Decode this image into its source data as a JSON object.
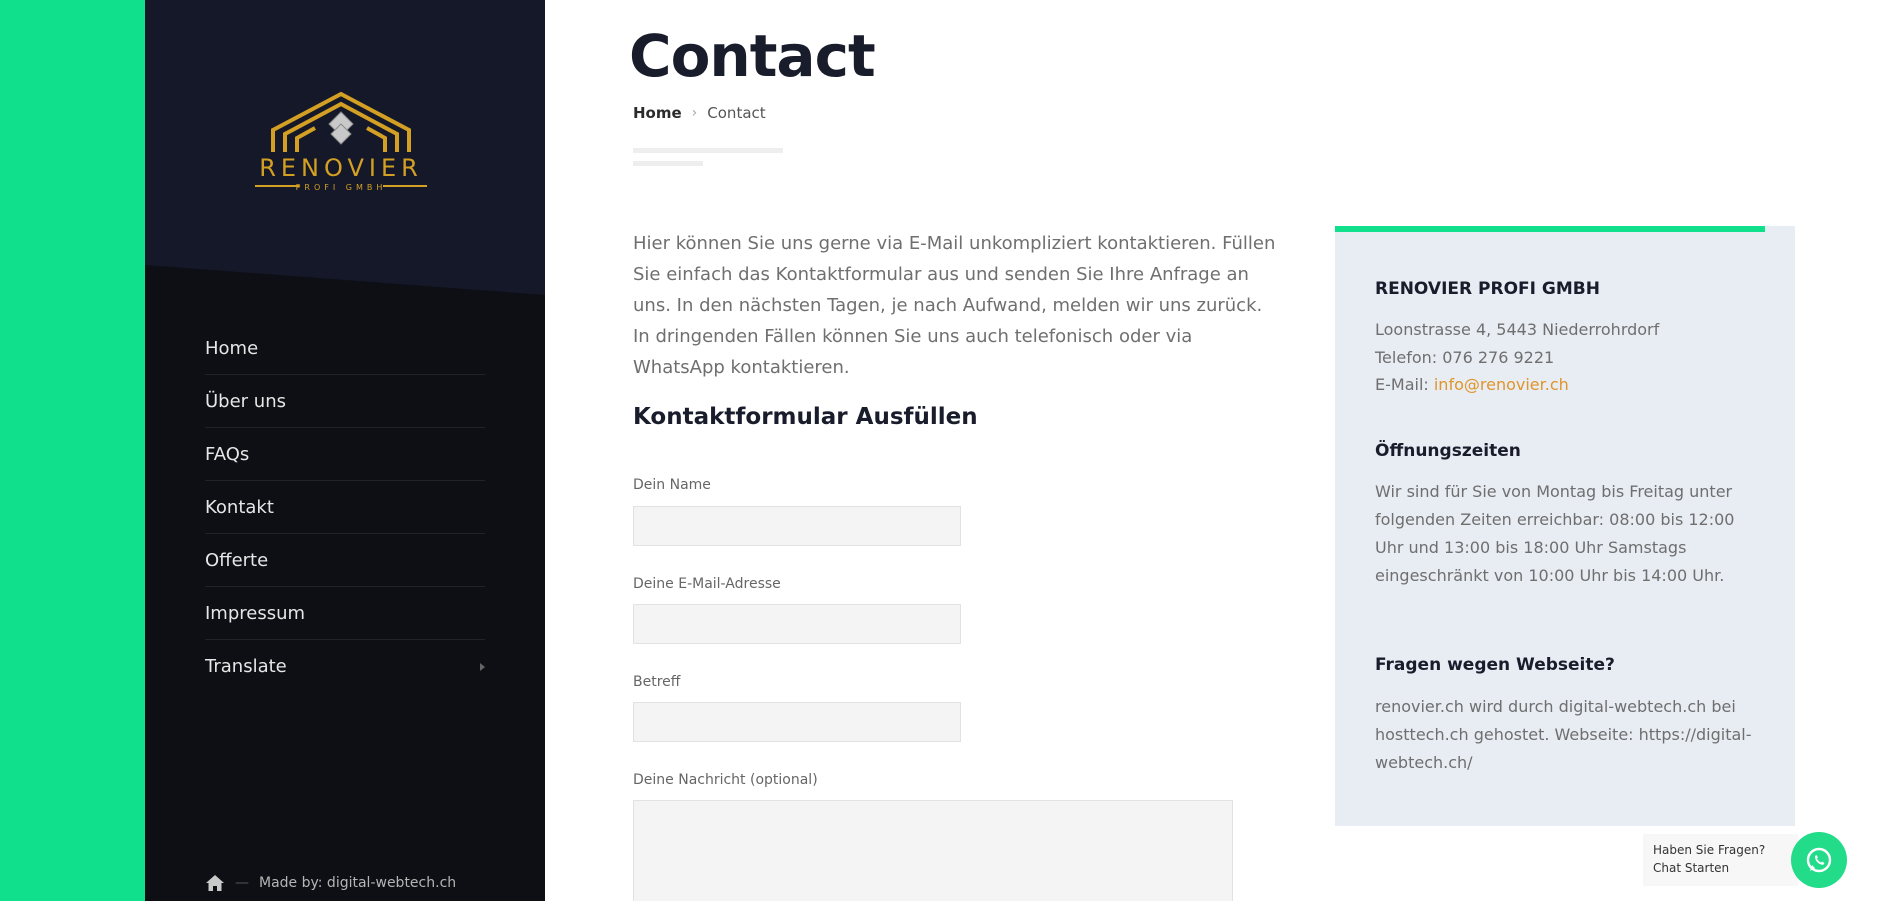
{
  "brand": {
    "name": "RENOVIER",
    "sub": "PROFI GMBH",
    "accent_color": "#10e08c",
    "logo_color": "#d4a024"
  },
  "nav": {
    "items": [
      {
        "label": "Home"
      },
      {
        "label": "Über uns"
      },
      {
        "label": "FAQs"
      },
      {
        "label": "Kontakt"
      },
      {
        "label": "Offerte"
      },
      {
        "label": "Impressum"
      },
      {
        "label": "Translate"
      }
    ]
  },
  "footer": {
    "credit": "Made by: digital-webtech.ch",
    "separator": "—"
  },
  "page": {
    "title": "Contact",
    "breadcrumb": {
      "home": "Home",
      "current": "Contact"
    },
    "intro": "Hier können Sie uns gerne via E-Mail unkompliziert kontaktieren. Füllen Sie einfach das Kontaktformular aus und senden Sie Ihre Anfrage an uns. In den nächsten Tagen, je nach Aufwand, melden wir uns zurück. In dringenden Fällen können Sie uns auch telefonisch oder via WhatsApp kontaktieren."
  },
  "form": {
    "title": "Kontaktformular Ausfüllen",
    "name_label": "Dein Name",
    "name_value": "",
    "email_label": "Deine E-Mail-Adresse",
    "email_value": "",
    "subject_label": "Betreff",
    "subject_value": "",
    "message_label": "Deine Nachricht (optional)",
    "message_value": ""
  },
  "info": {
    "company": "RENOVIER PROFI GMBH",
    "address": "Loonstrasse 4, 5443 Niederrohrdorf",
    "phone": "Telefon: 076 276 9221",
    "email_prefix": "E-Mail: ",
    "email": "info@renovier.ch",
    "hours_title": "Öffnungszeiten",
    "hours_text": "Wir sind für Sie von Montag bis Freitag unter folgenden Zeiten erreichbar: 08:00 bis 12:00 Uhr und 13:00 bis 18:00 Uhr Samstags eingeschränkt von 10:00 Uhr bis 14:00 Uhr.",
    "web_title": "Fragen wegen Webseite?",
    "web_text": "renovier.ch wird durch digital-webtech.ch bei hosttech.ch gehostet. Webseite: https://digital-webtech.ch/"
  },
  "chat": {
    "label": "Haben Sie Fragen? Chat Starten",
    "icon": "whatsapp-icon"
  }
}
